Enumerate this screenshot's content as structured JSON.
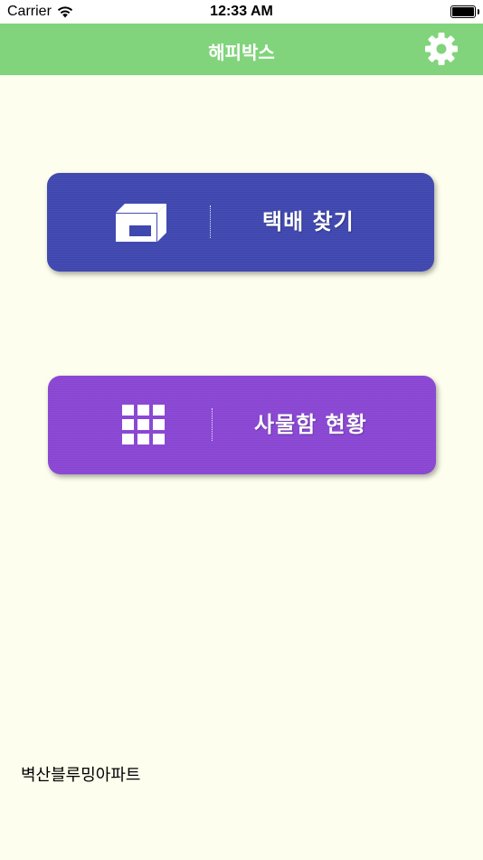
{
  "status_bar": {
    "carrier": "Carrier",
    "time": "12:33 AM"
  },
  "nav": {
    "title": "해피박스",
    "settings_icon": "gear-icon"
  },
  "buttons": {
    "find_parcel": {
      "label": "택배 찾기",
      "icon": "box-icon",
      "color": "#3f47b0"
    },
    "locker_status": {
      "label": "사물함 현황",
      "icon": "grid-icon",
      "color": "#8a46d4"
    }
  },
  "footer": {
    "apartment_name": "벽산블루밍아파트"
  },
  "colors": {
    "nav_bar": "#81d47b",
    "background": "#fefeee"
  }
}
